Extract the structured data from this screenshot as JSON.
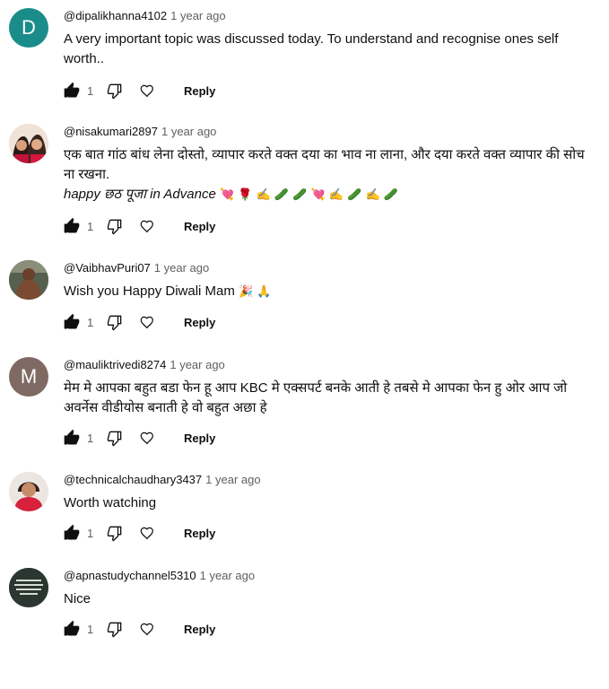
{
  "colors": {
    "avatar_d": "#1a8c8a",
    "avatar_m": "#7f6a63",
    "reply": "#0f0f0f",
    "meta": "#606060"
  },
  "icons": {
    "like": "thumb-up-filled-icon",
    "dislike": "thumb-down-outline-icon",
    "heart": "heart-outline-icon"
  },
  "reply_label": "Reply",
  "comments": [
    {
      "author": "@dipalikhanna4102",
      "time": "1 year ago",
      "avatar_letter": "D",
      "text": "A very important topic was discussed today. To understand and recognise ones self worth..",
      "likes": "1"
    },
    {
      "author": "@nisakumari2897",
      "time": "1 year ago",
      "text": "एक बात गांठ बांध लेना दोस्तो, व्यापार करते वक्त दया का भाव ना लाना, और दया करते वक्त व्यापार की सोच ना रखना.",
      "text_extra": "happy छठ पूजा in Advance",
      "text_extra_emoji": "💘 🌹 ✍️ 🥒 🥒 💘 ✍️ 🥒 ✍️ 🥒",
      "likes": "1"
    },
    {
      "author": "@VaibhavPuri07",
      "time": "1 year ago",
      "text": "Wish you Happy Diwali Mam",
      "text_emoji": "🎉 🙏",
      "likes": "1"
    },
    {
      "author": "@mauliktrivedi8274",
      "time": "1 year ago",
      "avatar_letter": "M",
      "text": "मेम मे  आपका बहुत बडा फेन हू आप KBC मे एक्सपर्ट बनके आती हे तबसे मे आपका फेन हु ओर आप जो अवर्नेस वीडीयोस बनाती हे वो बहुत अछा हे",
      "likes": "1"
    },
    {
      "author": "@technicalchaudhary3437",
      "time": "1 year ago",
      "text": "Worth watching",
      "likes": "1"
    },
    {
      "author": "@apnastudychannel5310",
      "time": "1 year ago",
      "text": "Nice",
      "likes": "1"
    }
  ]
}
